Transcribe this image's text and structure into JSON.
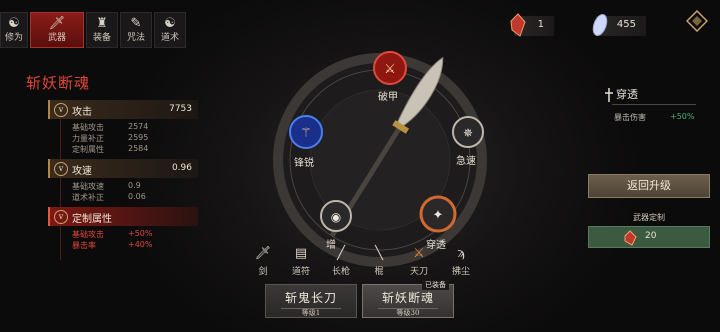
{
  "nav": {
    "tabs": [
      {
        "label": "修为",
        "icon": "cultivation-icon"
      },
      {
        "label": "武器",
        "icon": "sword-icon",
        "active": true
      },
      {
        "label": "装备",
        "icon": "armor-icon"
      },
      {
        "label": "咒法",
        "icon": "spell-icon"
      },
      {
        "label": "道术",
        "icon": "taiji-icon"
      }
    ]
  },
  "resources": {
    "stone": "1",
    "crystal": "455"
  },
  "weapon_name": "斩妖断魂",
  "stats": {
    "attack": {
      "label": "攻击",
      "value": "7753",
      "rows": [
        {
          "k": "基础攻击",
          "v": "2574"
        },
        {
          "k": "力量补正",
          "v": "2595"
        },
        {
          "k": "定制属性",
          "v": "2584"
        }
      ]
    },
    "speed": {
      "label": "攻速",
      "value": "0.96",
      "rows": [
        {
          "k": "基础攻速",
          "v": "0.9"
        },
        {
          "k": "道术补正",
          "v": "0.06"
        }
      ]
    },
    "custom": {
      "label": "定制属性",
      "rows": [
        {
          "k": "基础攻击",
          "v": "+50%"
        },
        {
          "k": "暴击率",
          "v": "+40%"
        }
      ]
    }
  },
  "wheel": {
    "nodes": {
      "top": "破甲",
      "left": "锋锐",
      "right": "急速",
      "bottom_right": "穿透",
      "bottom_left": "增"
    }
  },
  "weapon_types": [
    "剑",
    "道符",
    "长枪",
    "棍",
    "天刀",
    "拂尘"
  ],
  "bottom_buttons": [
    {
      "name": "斩鬼长刀",
      "level": "等级1"
    },
    {
      "name": "斩妖断魂",
      "level": "等级30",
      "tag": "已装备"
    }
  ],
  "right_panel": {
    "title": "穿透",
    "stat_label": "暴击伤害",
    "stat_value": "+50%",
    "return_button": "返回升级",
    "custom_header": "武器定制",
    "custom_value": "20"
  },
  "colors": {
    "accent_red": "#e0473b",
    "gold": "#c9a26a",
    "green": "#4fb16a"
  }
}
